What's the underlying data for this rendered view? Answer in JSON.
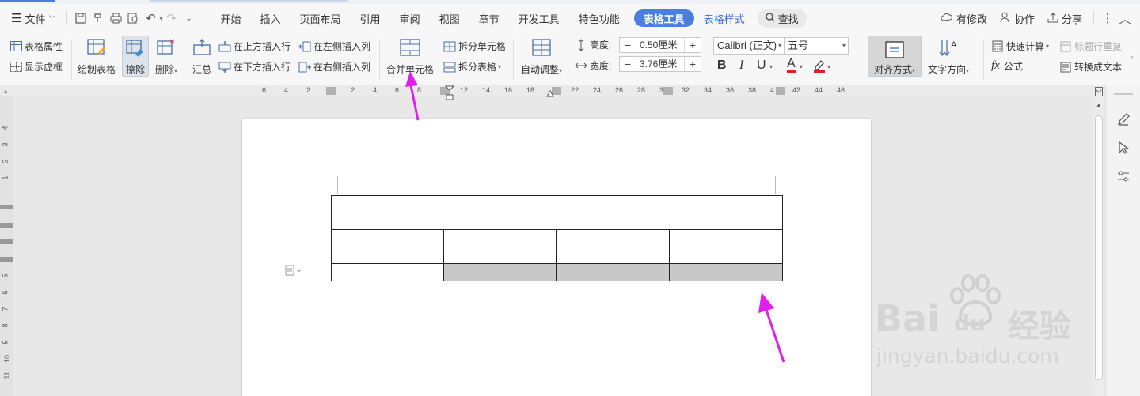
{
  "menubar": {
    "file_label": "文件",
    "tabs": [
      {
        "label": "开始"
      },
      {
        "label": "插入"
      },
      {
        "label": "页面布局"
      },
      {
        "label": "引用"
      },
      {
        "label": "审阅"
      },
      {
        "label": "视图"
      },
      {
        "label": "章节"
      },
      {
        "label": "开发工具"
      },
      {
        "label": "特色功能"
      },
      {
        "label": "表格工具"
      },
      {
        "label": "表格样式"
      }
    ],
    "search_label": "查找",
    "right": {
      "changes_label": "有修改",
      "collab_label": "协作",
      "share_label": "分享"
    }
  },
  "ribbon": {
    "table_props": "表格属性",
    "show_gridlines": "显示虚框",
    "draw_table": "绘制表格",
    "erase": "擦除",
    "delete": "删除",
    "summary": "汇总",
    "insert_above": "在上方插入行",
    "insert_below": "在下方插入行",
    "insert_left": "在左侧插入列",
    "insert_right": "在右侧插入列",
    "merge_cells": "合并单元格",
    "split_cells": "拆分单元格",
    "split_table": "拆分表格",
    "auto_fit": "自动调整",
    "height_label": "高度:",
    "height_value": "0.50厘米",
    "width_label": "宽度:",
    "width_value": "3.76厘米",
    "font_name": "Calibri (正文)",
    "font_size": "五号",
    "bold": "B",
    "italic": "I",
    "underline": "U",
    "font_color": "A",
    "align": "对齐方式",
    "text_direction": "文字方向",
    "quick_calc": "快速计算",
    "repeat_header": "标题行重复",
    "formula": "公式",
    "convert_text": "转换成文本"
  },
  "ruler": {
    "h_ticks": [
      "6",
      "4",
      "2",
      "2",
      "4",
      "6",
      "8",
      "12",
      "14",
      "16",
      "18",
      "22",
      "24",
      "26",
      "28",
      "3",
      "32",
      "34",
      "36",
      "38",
      "4",
      "42",
      "44",
      "46"
    ],
    "v_ticks": [
      "4",
      "3",
      "2",
      "1",
      "5",
      "6",
      "7",
      "8",
      "9",
      "10",
      "11"
    ]
  },
  "watermark": {
    "brand_a": "Bai",
    "brand_b": "du",
    "brand_c": "经验",
    "url": "jingyan.baidu.com"
  },
  "colors": {
    "accent": "#4a7fe0",
    "arrow": "#e020e8",
    "selection": "#c8c8c8"
  }
}
